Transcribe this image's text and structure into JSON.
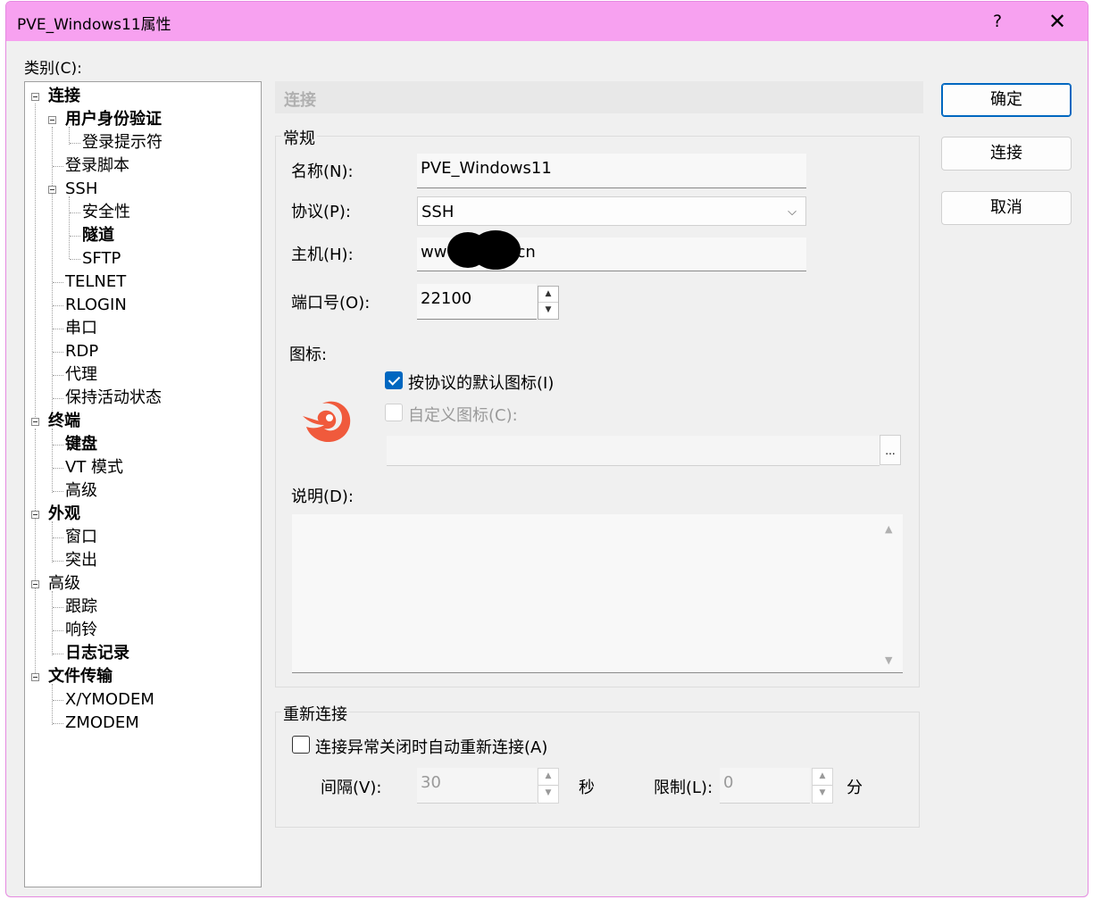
{
  "window": {
    "title": "PVE_Windows11属性",
    "help": "?",
    "close": "✕"
  },
  "category_label": "类别(C):",
  "tree": [
    {
      "label": "连接",
      "bold": true
    },
    {
      "label": "用户身份验证",
      "bold": true
    },
    {
      "label": "登录提示符",
      "bold": false
    },
    {
      "label": "登录脚本",
      "bold": false
    },
    {
      "label": "SSH",
      "bold": false
    },
    {
      "label": "安全性",
      "bold": false
    },
    {
      "label": "隧道",
      "bold": true
    },
    {
      "label": "SFTP",
      "bold": false
    },
    {
      "label": "TELNET",
      "bold": false
    },
    {
      "label": "RLOGIN",
      "bold": false
    },
    {
      "label": "串口",
      "bold": false
    },
    {
      "label": "RDP",
      "bold": false
    },
    {
      "label": "代理",
      "bold": false
    },
    {
      "label": "保持活动状态",
      "bold": false
    },
    {
      "label": "终端",
      "bold": true
    },
    {
      "label": "键盘",
      "bold": true
    },
    {
      "label": "VT 模式",
      "bold": false
    },
    {
      "label": "高级",
      "bold": false
    },
    {
      "label": "外观",
      "bold": true
    },
    {
      "label": "窗口",
      "bold": false
    },
    {
      "label": "突出",
      "bold": false
    },
    {
      "label": "高级",
      "bold": false
    },
    {
      "label": "跟踪",
      "bold": false
    },
    {
      "label": "响铃",
      "bold": false
    },
    {
      "label": "日志记录",
      "bold": true
    },
    {
      "label": "文件传输",
      "bold": true
    },
    {
      "label": "X/YMODEM",
      "bold": false
    },
    {
      "label": "ZMODEM",
      "bold": false
    }
  ],
  "panel": {
    "header": "连接",
    "general_group": "常规",
    "name_label": "名称(N):",
    "name_value": "PVE_Windows11",
    "protocol_label": "协议(P):",
    "protocol_value": "SSH",
    "host_label": "主机(H):",
    "host_prefix": "ww",
    "host_suffix": "cn",
    "port_label": "端口号(O):",
    "port_value": "22100",
    "icon_label": "图标:",
    "default_icon_label": "按协议的默认图标(I)",
    "custom_icon_label": "自定义图标(C):",
    "browse_label": "...",
    "desc_label": "说明(D):",
    "desc_value": "",
    "reconnect_group": "重新连接",
    "auto_reconnect_label": "连接异常关闭时自动重新连接(A)",
    "interval_label": "间隔(V):",
    "interval_value": "30",
    "interval_unit": "秒",
    "limit_label": "限制(L):",
    "limit_value": "0",
    "limit_unit": "分"
  },
  "buttons": {
    "ok": "确定",
    "connect": "连接",
    "cancel": "取消"
  },
  "colors": {
    "titlebar": "#f7a1f0",
    "accent": "#0067c0",
    "icon": "#f05a3c"
  },
  "state": {
    "default_icon_checked": true,
    "custom_icon_checked": false,
    "auto_reconnect_checked": false
  }
}
